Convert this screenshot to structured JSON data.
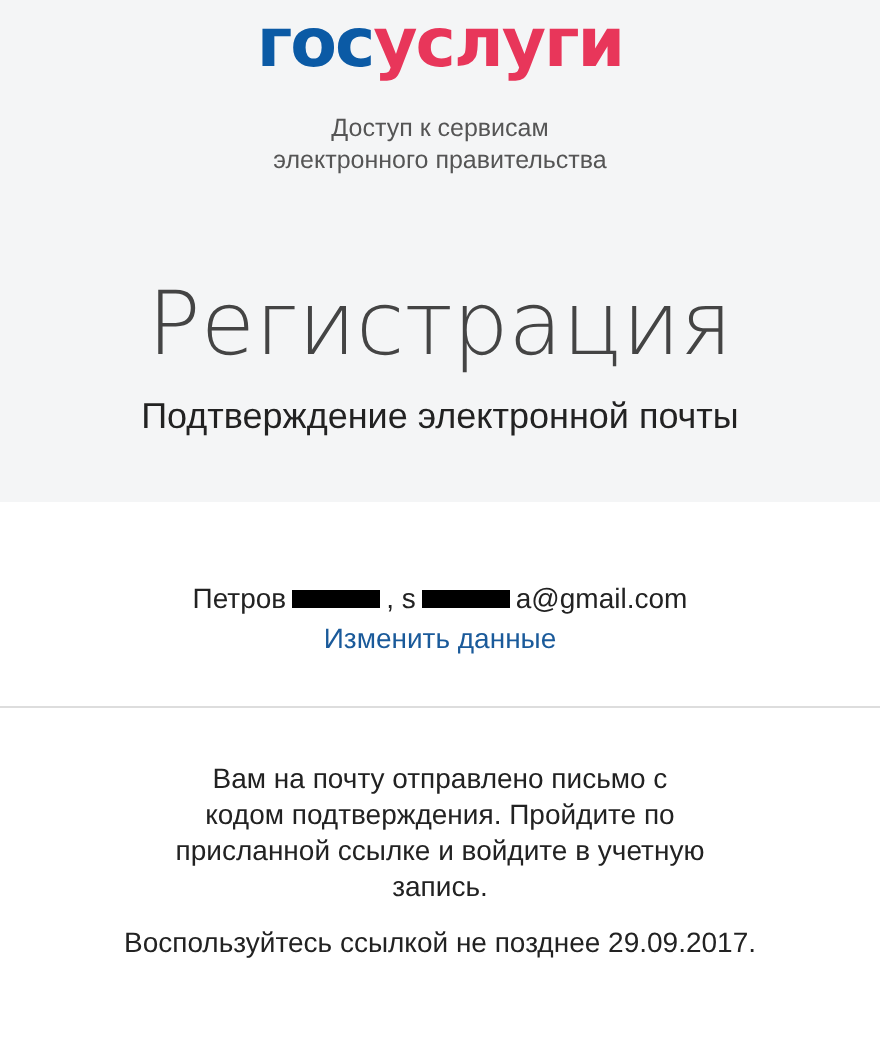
{
  "logo": {
    "parts": [
      {
        "text": "гос",
        "color": "#0b5aa5"
      },
      {
        "text": "услуги",
        "color": "#e8365a"
      }
    ]
  },
  "tagline": [
    "Доступ к сервисам",
    "электронного правительства"
  ],
  "title": "Регистрация",
  "subtitle": "Подтверждение электронной почты",
  "contact": {
    "segments": [
      {
        "kind": "text",
        "text": "Петров"
      },
      {
        "kind": "redacted"
      },
      {
        "kind": "text",
        "text": ", s"
      },
      {
        "kind": "redacted"
      },
      {
        "kind": "text",
        "text": "a@gmail.com"
      }
    ],
    "link": "Изменить данные"
  },
  "message": "Вам на почту отправлено письмо с кодом подтверждения. Пройдите по присланной ссылке и войдите в учетную запись.",
  "deadline": "Воспользуйтесь ссылкой не позднее 29.09.2017."
}
